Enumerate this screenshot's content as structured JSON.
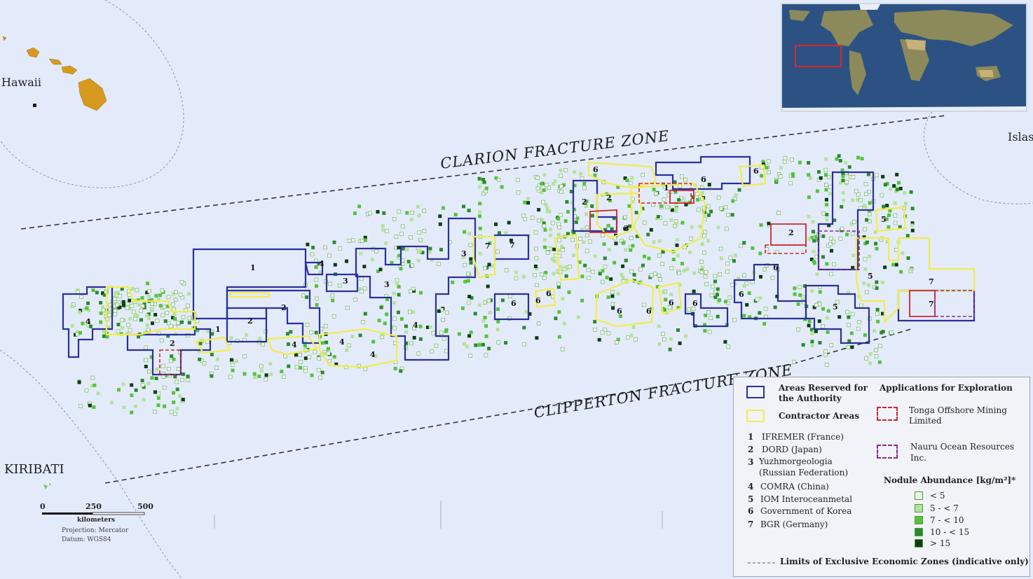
{
  "places": {
    "hawaii": "Hawaii",
    "kiribati": "KIRIBATI",
    "islas": "Islas"
  },
  "zones": {
    "clarion": "CLARION FRACTURE ZONE",
    "clipperton": "CLIPPERTON FRACTURE ZONE"
  },
  "scale": {
    "ticks": [
      "0",
      "250",
      "500"
    ],
    "unit": "kilometers",
    "projection": "Projection: Mercator",
    "datum": "Datum: WGS84"
  },
  "legend": {
    "reserved": "Areas Reserved for the Authority",
    "reserved_line1": "Areas Reserved for",
    "reserved_line2": "the Authority",
    "contractor": "Contractor Areas",
    "applications_title": "Applications for Exploration",
    "tonga_line1": "Tonga Offshore Mining",
    "tonga_line2": "Limited",
    "nauru_line1": "Nauru Ocean Resources",
    "nauru_line2": "Inc.",
    "contractors": [
      {
        "n": "1",
        "name": "IFREMER (France)"
      },
      {
        "n": "2",
        "name": "DORD (Japan)"
      },
      {
        "n": "3",
        "name": "Yuzhmorgeologia",
        "name2": "(Russian Federation)"
      },
      {
        "n": "4",
        "name": "COMRA (China)"
      },
      {
        "n": "5",
        "name": "IOM Interoceanmetal"
      },
      {
        "n": "6",
        "name": "Government of Korea"
      },
      {
        "n": "7",
        "name": "BGR (Germany)"
      }
    ],
    "abundance_title": "Nodule Abundance [kg/m²]*",
    "abundance_classes": [
      "< 5",
      "5 - < 7",
      "7 - < 10",
      "10 - < 15",
      "> 15"
    ],
    "eez": "Limits of Exclusive Economic Zones (indicative only)"
  },
  "colors": {
    "ocean": "#e3ebfb",
    "reserved": "#2b2f9a",
    "contractor": "#f2ec4a",
    "tonga": "#d2242c",
    "nauru": "#8a2b8f",
    "land": "#d69a1e",
    "abundance": [
      "#ecf7e6",
      "#b6e29a",
      "#56c23c",
      "#2b8a2b",
      "#0d3d12"
    ]
  }
}
